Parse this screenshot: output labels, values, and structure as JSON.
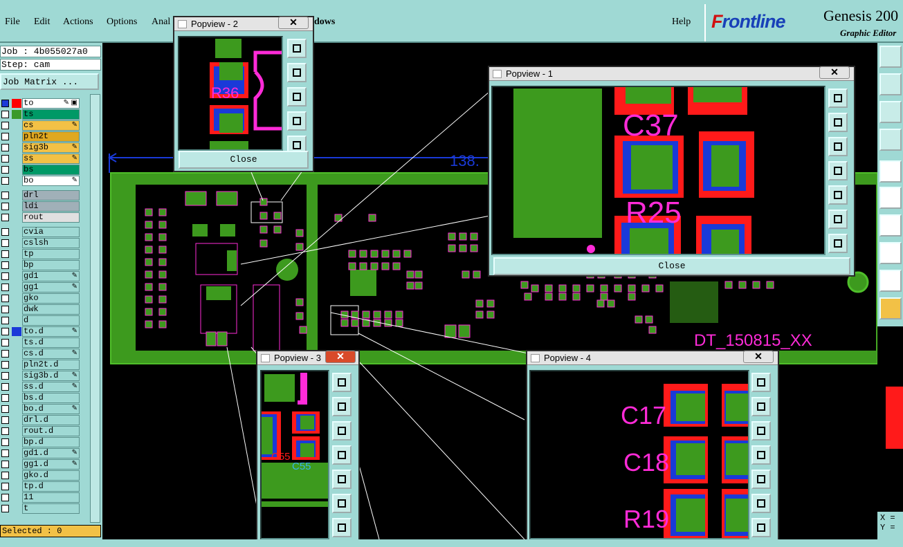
{
  "menu": {
    "file": "File",
    "edit": "Edit",
    "actions": "Actions",
    "options": "Options",
    "analysis_partial": "Anal",
    "windows_partial": "dows",
    "help": "Help"
  },
  "logo": {
    "brand_a": "F",
    "brand_b": "rontline",
    "product": "Genesis 200",
    "subtitle": "Graphic Editor"
  },
  "info": {
    "job": "Job : 4b055027a0",
    "step": "Step: cam",
    "job_matrix": "Job Matrix ..."
  },
  "layers": [
    {
      "name": "to",
      "color": "#ffffff",
      "swatch": "#ff0000",
      "edit": "✎ ▣",
      "sel": true
    },
    {
      "name": "ts",
      "color": "#009966",
      "swatch": "#3a9a2a",
      "edit": ""
    },
    {
      "name": "cs",
      "color": "#f2c146",
      "swatch": "",
      "edit": "✎"
    },
    {
      "name": "pln2t",
      "color": "#e0a820",
      "swatch": "",
      "edit": ""
    },
    {
      "name": "sig3b",
      "color": "#f2c146",
      "swatch": "",
      "edit": "✎"
    },
    {
      "name": "ss",
      "color": "#f2c146",
      "swatch": "",
      "edit": "✎"
    },
    {
      "name": "bs",
      "color": "#009966",
      "swatch": "",
      "edit": ""
    },
    {
      "name": "bo",
      "color": "#ffffff",
      "swatch": "",
      "edit": "✎"
    },
    {
      "name": "drl",
      "color": "#a0b0b8",
      "swatch": "",
      "edit": ""
    },
    {
      "name": "ldi",
      "color": "#a0b0b8",
      "swatch": "",
      "edit": ""
    },
    {
      "name": "rout",
      "color": "#e0e0e0",
      "swatch": "",
      "edit": ""
    },
    {
      "name": "cvia",
      "color": "#9fd9d4",
      "swatch": "",
      "edit": ""
    },
    {
      "name": "cslsh",
      "color": "#9fd9d4",
      "swatch": "",
      "edit": ""
    },
    {
      "name": "tp",
      "color": "#9fd9d4",
      "swatch": "",
      "edit": ""
    },
    {
      "name": "bp",
      "color": "#9fd9d4",
      "swatch": "",
      "edit": ""
    },
    {
      "name": "gd1",
      "color": "#9fd9d4",
      "swatch": "",
      "edit": "✎"
    },
    {
      "name": "gg1",
      "color": "#9fd9d4",
      "swatch": "",
      "edit": "✎"
    },
    {
      "name": "gko",
      "color": "#9fd9d4",
      "swatch": "",
      "edit": ""
    },
    {
      "name": "dwk",
      "color": "#9fd9d4",
      "swatch": "",
      "edit": ""
    },
    {
      "name": "d",
      "color": "#9fd9d4",
      "swatch": "",
      "edit": ""
    },
    {
      "name": "to.d",
      "color": "#9fd9d4",
      "swatch": "#1a3ad8",
      "edit": "✎"
    },
    {
      "name": "ts.d",
      "color": "#9fd9d4",
      "swatch": "",
      "edit": ""
    },
    {
      "name": "cs.d",
      "color": "#9fd9d4",
      "swatch": "",
      "edit": "✎"
    },
    {
      "name": "pln2t.d",
      "color": "#9fd9d4",
      "swatch": "",
      "edit": ""
    },
    {
      "name": "sig3b.d",
      "color": "#9fd9d4",
      "swatch": "",
      "edit": "✎"
    },
    {
      "name": "ss.d",
      "color": "#9fd9d4",
      "swatch": "",
      "edit": "✎"
    },
    {
      "name": "bs.d",
      "color": "#9fd9d4",
      "swatch": "",
      "edit": ""
    },
    {
      "name": "bo.d",
      "color": "#9fd9d4",
      "swatch": "",
      "edit": "✎"
    },
    {
      "name": "drl.d",
      "color": "#9fd9d4",
      "swatch": "",
      "edit": ""
    },
    {
      "name": "rout.d",
      "color": "#9fd9d4",
      "swatch": "",
      "edit": ""
    },
    {
      "name": "bp.d",
      "color": "#9fd9d4",
      "swatch": "",
      "edit": ""
    },
    {
      "name": "gd1.d",
      "color": "#9fd9d4",
      "swatch": "",
      "edit": "✎"
    },
    {
      "name": "gg1.d",
      "color": "#9fd9d4",
      "swatch": "",
      "edit": "✎"
    },
    {
      "name": "gko.d",
      "color": "#9fd9d4",
      "swatch": "",
      "edit": ""
    },
    {
      "name": "tp.d",
      "color": "#9fd9d4",
      "swatch": "",
      "edit": ""
    },
    {
      "name": "11",
      "color": "#9fd9d4",
      "swatch": "",
      "edit": ""
    },
    {
      "name": "t",
      "color": "#9fd9d4",
      "swatch": "",
      "edit": ""
    }
  ],
  "selected": "Selected : 0",
  "board": {
    "dimension": "138.",
    "label": "DT_150815_XX"
  },
  "popups": {
    "p1": {
      "title": "Popview - 1",
      "close": "Close",
      "labels": [
        "C37",
        "R25"
      ]
    },
    "p2": {
      "title": "Popview - 2",
      "close": "Close",
      "labels": [
        "R36"
      ]
    },
    "p3": {
      "title": "Popview - 3",
      "labels": [
        "C55",
        "C55"
      ]
    },
    "p4": {
      "title": "Popview - 4",
      "labels": [
        "C17",
        "C18",
        "R19"
      ]
    }
  },
  "coords": {
    "x": "X =",
    "y": "Y ="
  }
}
